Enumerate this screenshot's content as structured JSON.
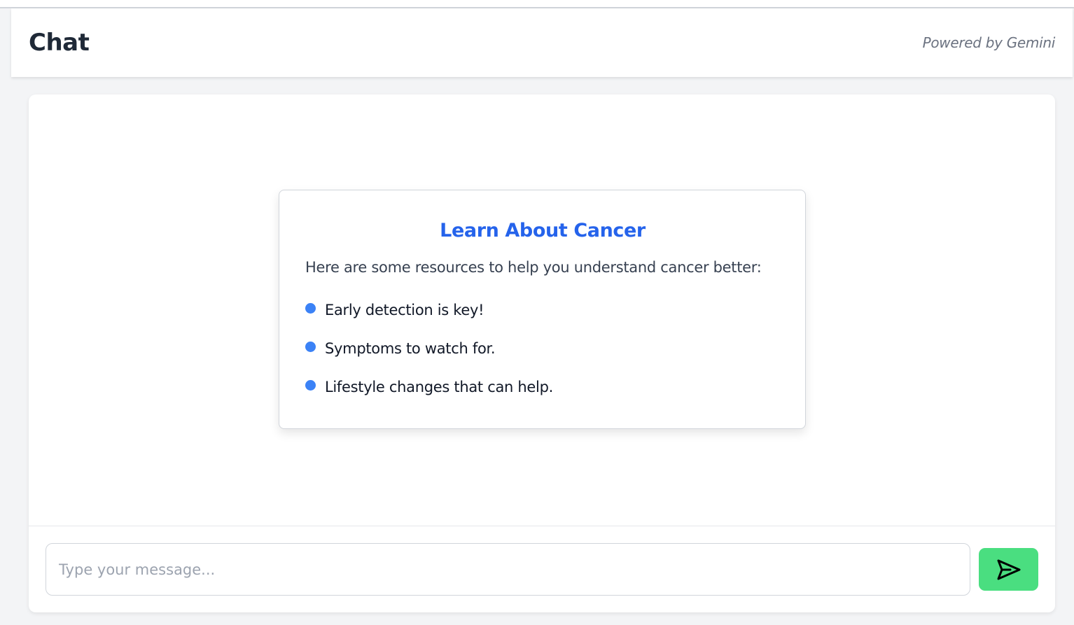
{
  "header": {
    "title": "Chat",
    "powered_by": "Powered by Gemini"
  },
  "card": {
    "title": "Learn About Cancer",
    "intro": "Here are some resources to help you understand cancer better:",
    "items": [
      "Early detection is key!",
      "Symptoms to watch for.",
      "Lifestyle changes that can help."
    ]
  },
  "composer": {
    "value": "",
    "placeholder": "Type your message...",
    "send_icon": "send-icon"
  },
  "colors": {
    "accent": "#2563eb",
    "bullet": "#3b82f6",
    "send_button": "#4ade80",
    "background": "#f3f4f6"
  }
}
